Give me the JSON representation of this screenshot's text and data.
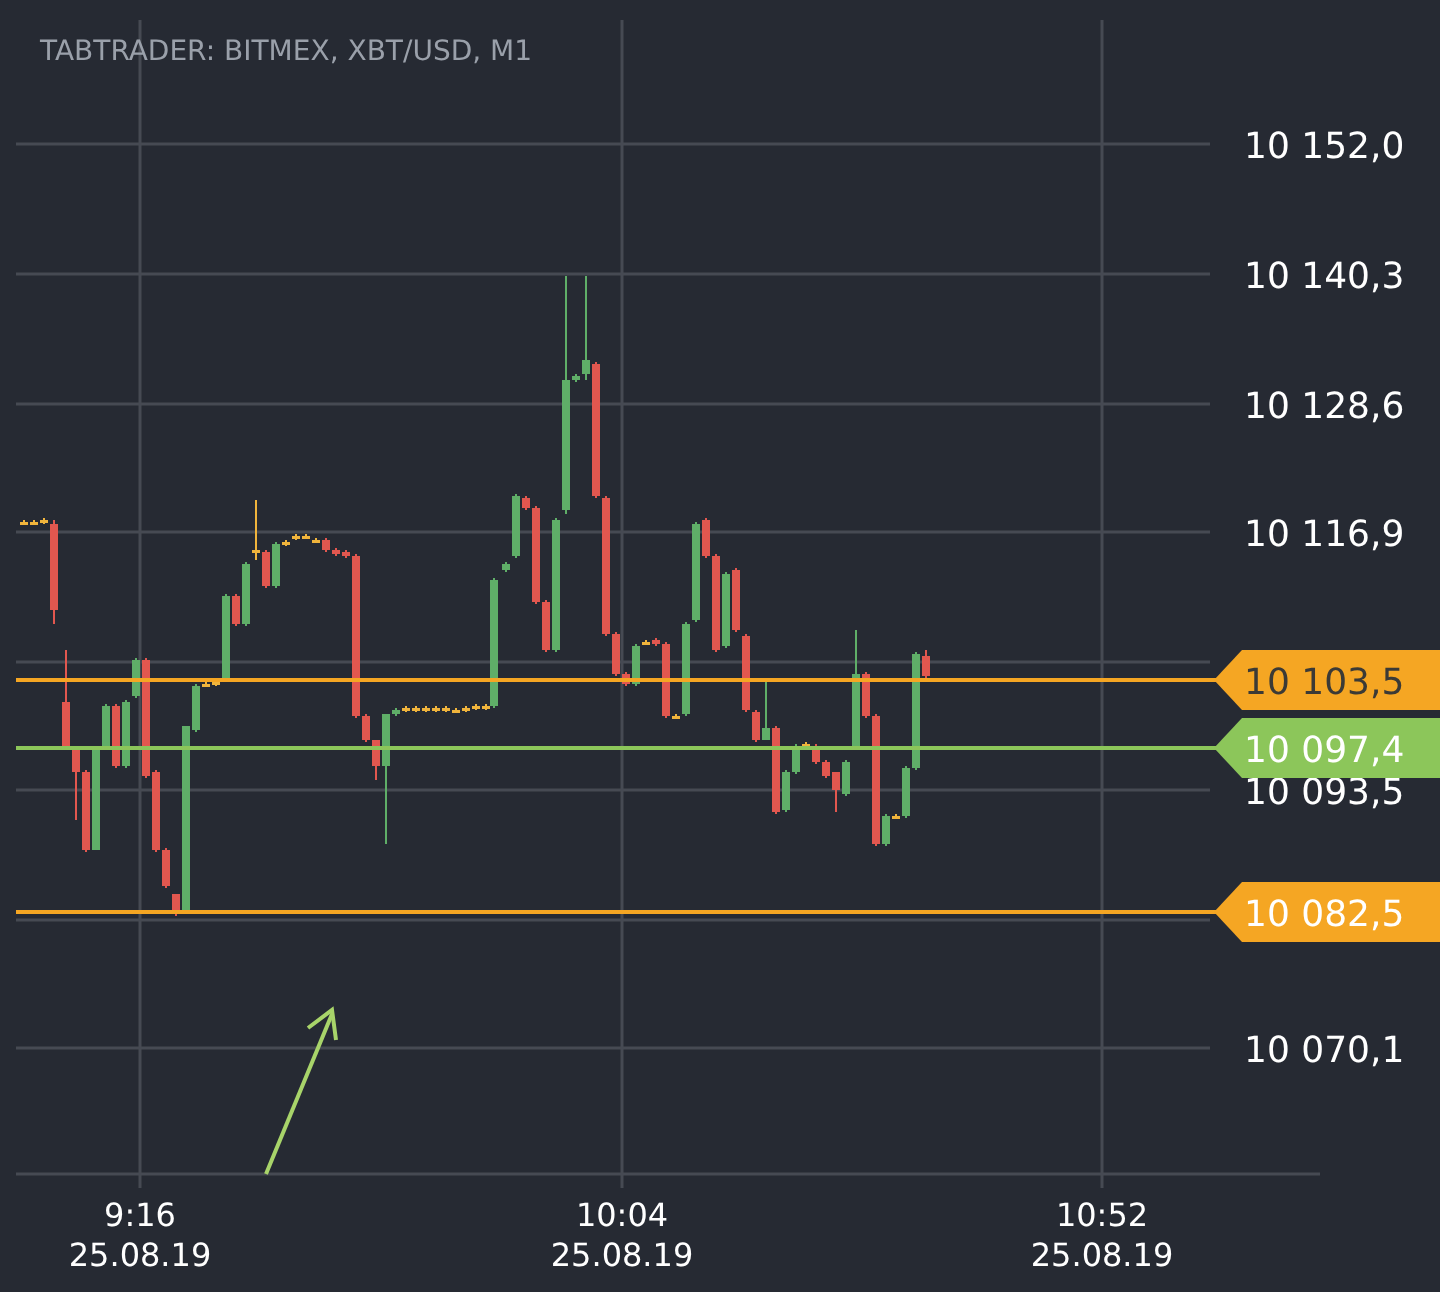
{
  "chart": {
    "title": "TABTRADER: BITMEX, XBT/USD, M1",
    "yticks": [
      "10 152,0",
      "10 140,3",
      "10 128,6",
      "10 116,9",
      "10 093,5",
      "10 070,1"
    ],
    "xticks": [
      {
        "time": "9:16",
        "date": "25.08.19"
      },
      {
        "time": "10:04",
        "date": "25.08.19"
      },
      {
        "time": "10:52",
        "date": "25.08.19"
      }
    ],
    "price_lines": [
      {
        "label": "10 103,5",
        "color": "#f5a623",
        "dark_text": true
      },
      {
        "label": "10 097,4",
        "color": "#8cc65a",
        "dark_text": false
      },
      {
        "label": "10 082,5",
        "color": "#f5a623",
        "dark_text": false
      }
    ]
  }
}
